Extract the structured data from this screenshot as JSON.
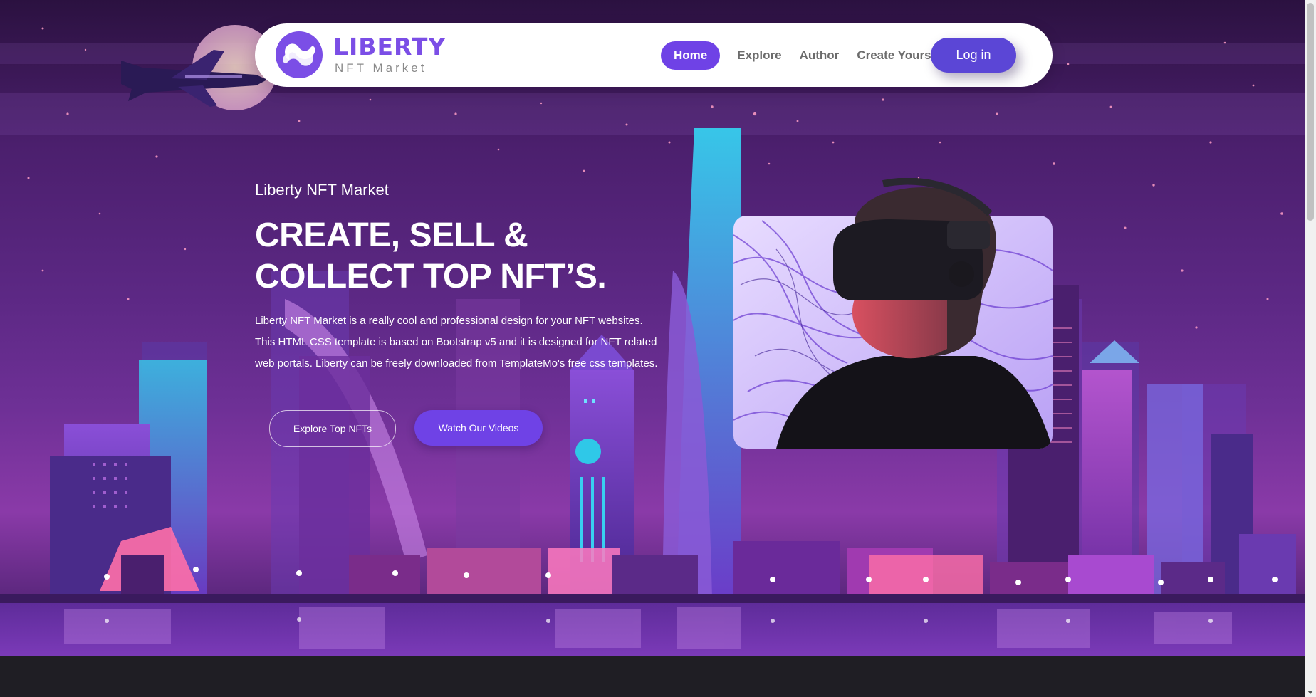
{
  "colors": {
    "accent": "#6f42e6",
    "login": "#5b46d6",
    "brand": "#7b4ee6",
    "nav_text": "#6c6c6c",
    "footer": "#1f1e24"
  },
  "brand": {
    "name": "LIBERTY",
    "subtitle": "NFT Market",
    "logo_icon": "liberty-logo-icon"
  },
  "nav": {
    "items": [
      {
        "label": "Home",
        "active": true
      },
      {
        "label": "Explore",
        "active": false
      },
      {
        "label": "Author",
        "active": false
      },
      {
        "label": "Create Yours",
        "active": false
      }
    ],
    "login_label": "Log in"
  },
  "hero": {
    "small_title": "Liberty NFT Market",
    "title_line1": "CREATE, SELL &",
    "title_line2": "COLLECT TOP NFT’S.",
    "description": "Liberty NFT Market is a really cool and professional design for your NFT websites. This HTML CSS template is based on Bootstrap v5 and it is designed for NFT related web portals. Liberty can be freely downloaded from TemplateMo's free css templates.",
    "button_explore": "Explore Top NFTs",
    "button_videos": "Watch Our Videos",
    "image_alt_icon": "vr-headset-person-image"
  }
}
